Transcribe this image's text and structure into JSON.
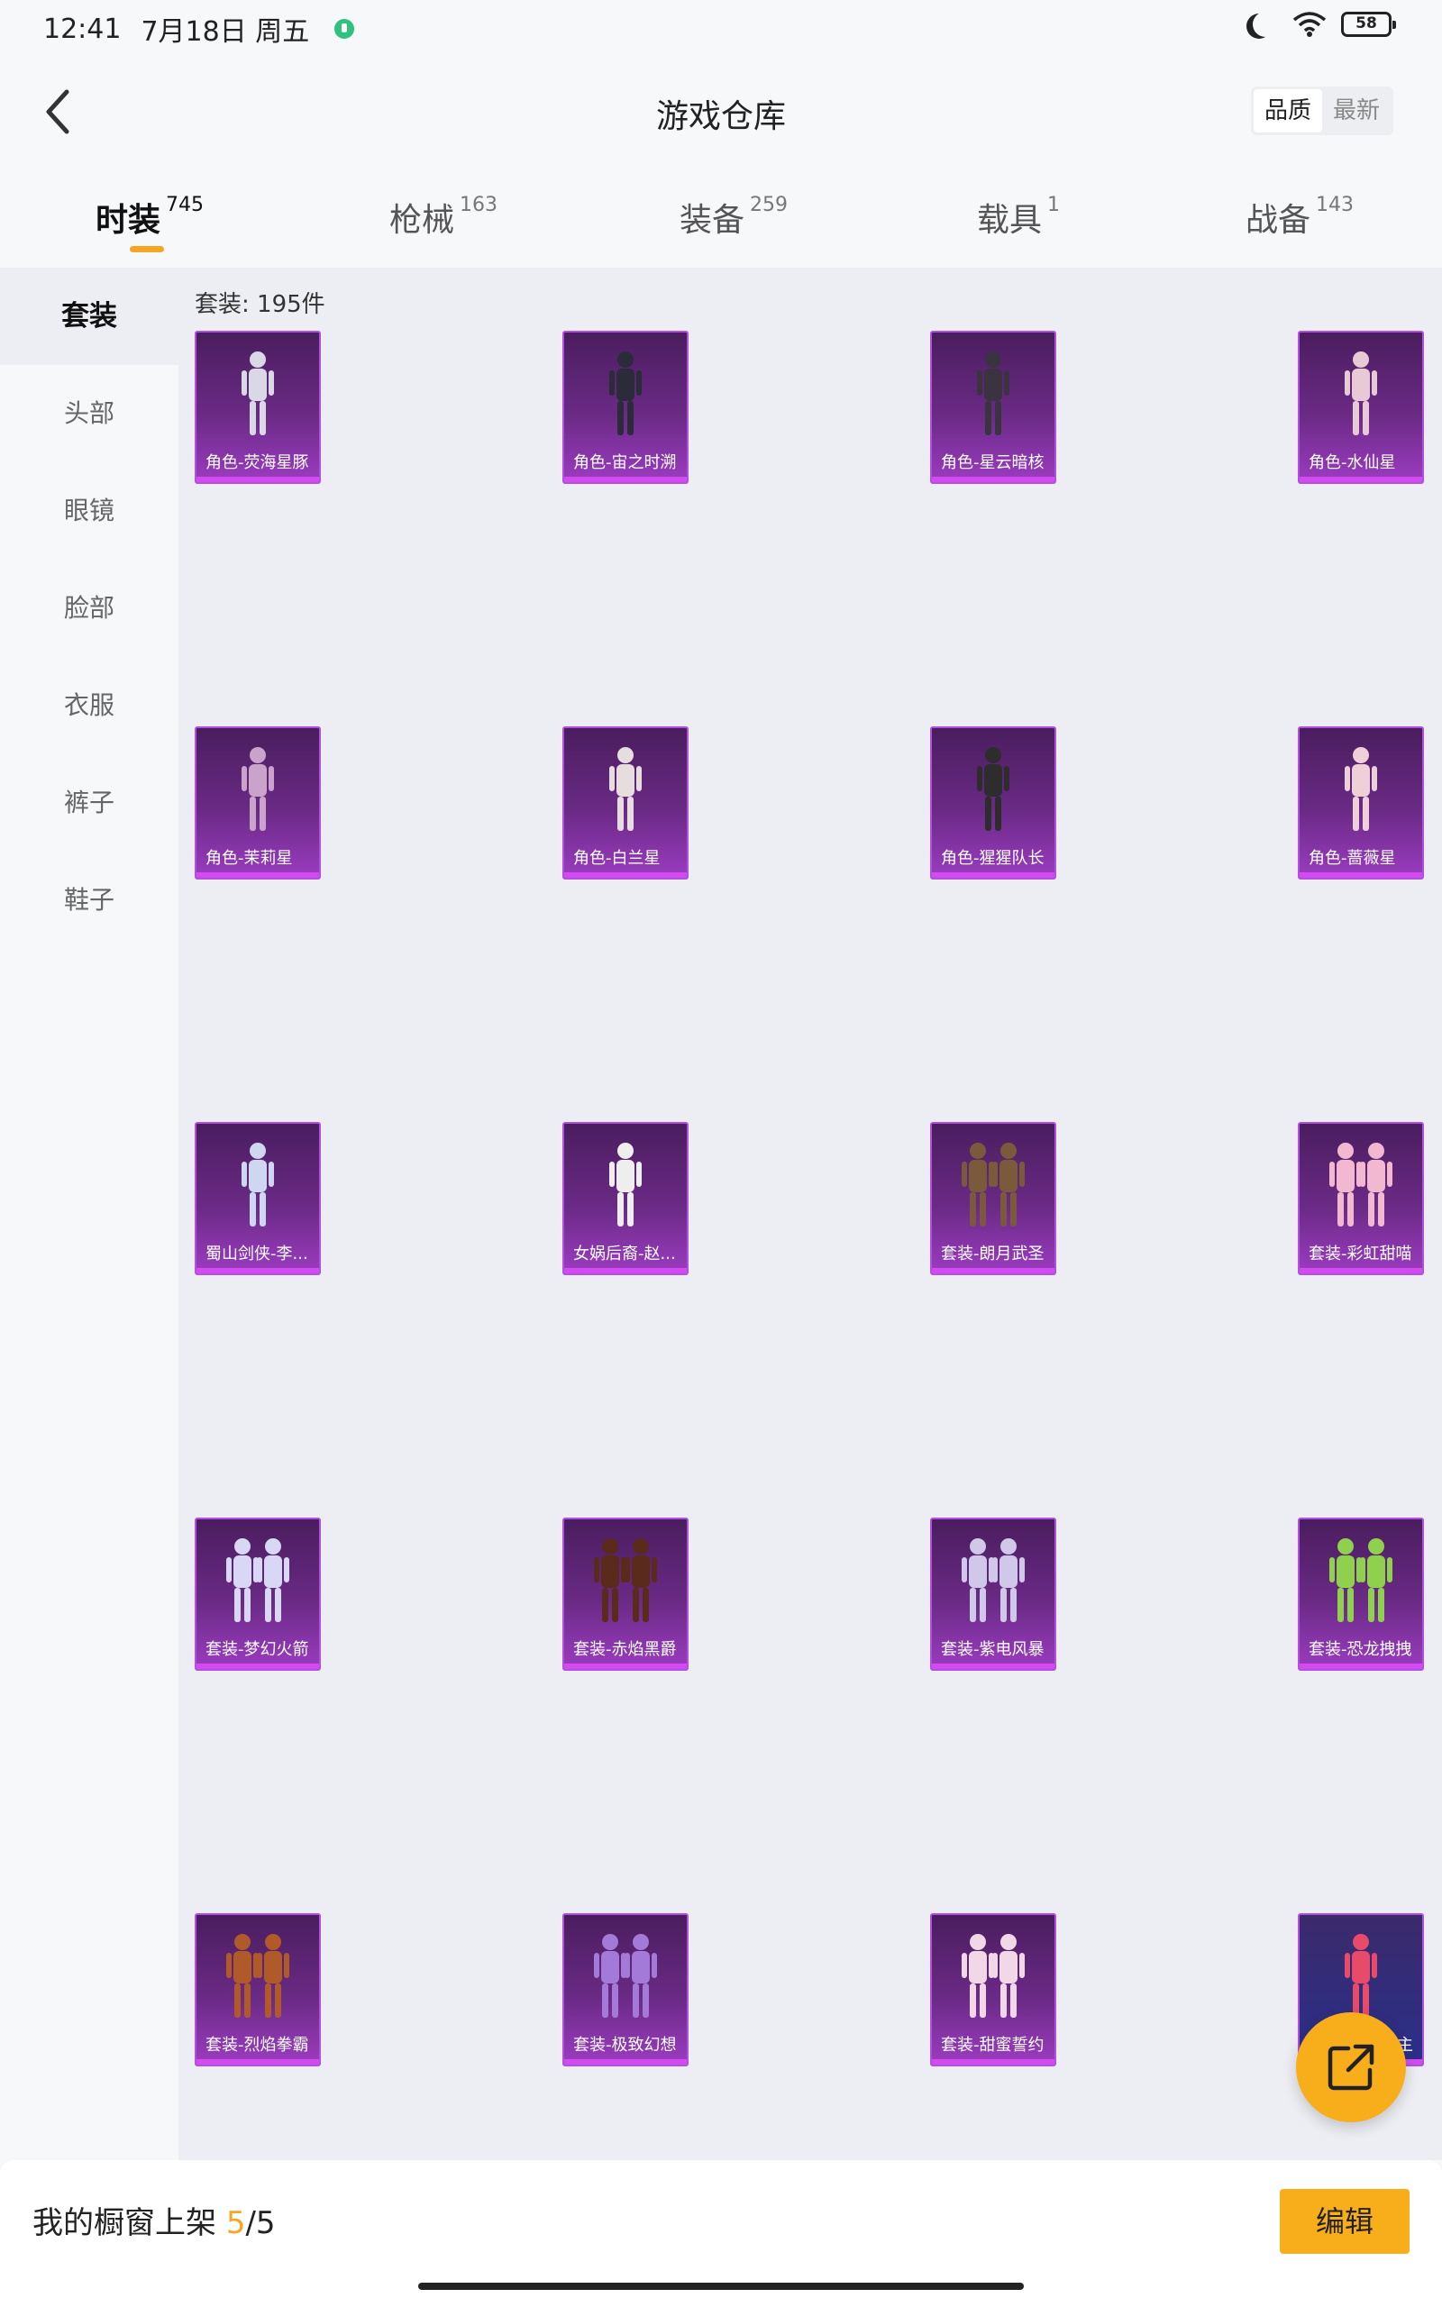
{
  "status_bar": {
    "time": "12:41",
    "date": "7月18日 周五",
    "battery": "58",
    "wifi_label": "6"
  },
  "header": {
    "title": "游戏仓库",
    "sort_options": [
      "品质",
      "最新"
    ],
    "active_sort": "品质"
  },
  "tabs": [
    {
      "label": "时装",
      "count": "745",
      "active": true
    },
    {
      "label": "枪械",
      "count": "163",
      "active": false
    },
    {
      "label": "装备",
      "count": "259",
      "active": false
    },
    {
      "label": "载具",
      "count": "1",
      "active": false
    },
    {
      "label": "战备",
      "count": "143",
      "active": false
    }
  ],
  "sidebar": {
    "items": [
      "套装",
      "头部",
      "眼镜",
      "脸部",
      "衣服",
      "裤子",
      "鞋子"
    ],
    "active": "套装"
  },
  "content": {
    "count_label": "套装: 195件",
    "items": [
      {
        "name": "角色-荧海星豚"
      },
      {
        "name": "角色-宙之时溯"
      },
      {
        "name": "角色-星云暗核"
      },
      {
        "name": "角色-水仙星"
      },
      {
        "name": "角色-茉莉星"
      },
      {
        "name": "角色-白兰星"
      },
      {
        "name": "角色-猩猩队长"
      },
      {
        "name": "角色-蔷薇星"
      },
      {
        "name": "蜀山剑侠-李..."
      },
      {
        "name": "女娲后裔-赵..."
      },
      {
        "name": "套装-朗月武圣"
      },
      {
        "name": "套装-彩虹甜喵"
      },
      {
        "name": "套装-梦幻火箭"
      },
      {
        "name": "套装-赤焰黑爵"
      },
      {
        "name": "套装-紫电风暴"
      },
      {
        "name": "套装-恐龙拽拽"
      },
      {
        "name": "套装-烈焰拳霸"
      },
      {
        "name": "套装-极致幻想"
      },
      {
        "name": "套装-甜蜜誓约"
      },
      {
        "name": "主"
      }
    ]
  },
  "bottom_bar": {
    "shelf_label": "我的橱窗上架",
    "shelf_current": "5",
    "shelf_total": "/5",
    "edit_label": "编辑"
  },
  "colors": {
    "accent": "#f8ae1a",
    "card_purple": "#6a2a85",
    "card_border": "#b14fe0"
  }
}
